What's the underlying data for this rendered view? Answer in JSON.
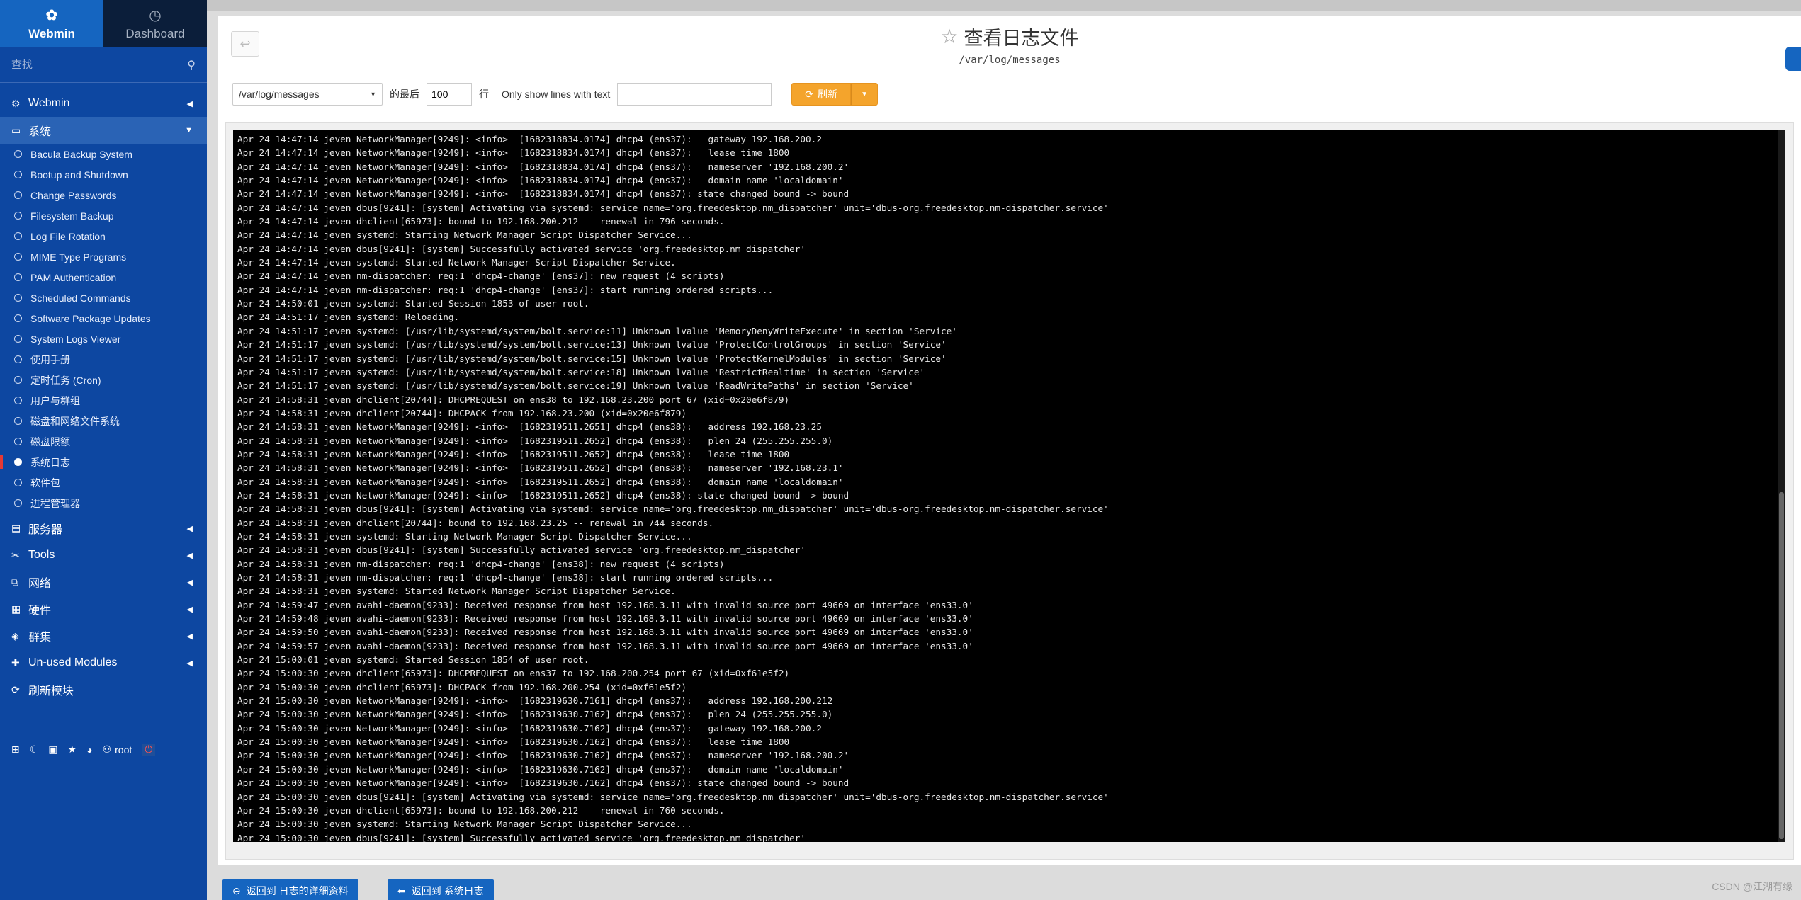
{
  "sidebar": {
    "tabs": {
      "webmin": "Webmin",
      "dashboard": "Dashboard"
    },
    "search_placeholder": "查找",
    "categories_top": [
      {
        "label": "Webmin",
        "icon": "gear-icon"
      },
      {
        "label": "系统",
        "icon": "laptop-icon",
        "open": true
      }
    ],
    "modules": [
      "Bacula Backup System",
      "Bootup and Shutdown",
      "Change Passwords",
      "Filesystem Backup",
      "Log File Rotation",
      "MIME Type Programs",
      "PAM Authentication",
      "Scheduled Commands",
      "Software Package Updates",
      "System Logs Viewer",
      "使用手册",
      "定时任务 (Cron)",
      "用户与群组",
      "磁盘和网络文件系统",
      "磁盘限额",
      "系统日志",
      "软件包",
      "进程管理器"
    ],
    "active_module": "系统日志",
    "categories_bottom": [
      {
        "label": "服务器",
        "icon": "server-icon"
      },
      {
        "label": "Tools",
        "icon": "tools-icon"
      },
      {
        "label": "网络",
        "icon": "network-icon"
      },
      {
        "label": "硬件",
        "icon": "hardware-icon"
      },
      {
        "label": "群集",
        "icon": "cluster-icon"
      },
      {
        "label": "Un-used Modules",
        "icon": "puzzle-icon"
      },
      {
        "label": "刷新模块",
        "icon": "refresh-icon"
      }
    ],
    "footer": {
      "user": "root"
    }
  },
  "header": {
    "title": "查看日志文件",
    "subtitle": "/var/log/messages"
  },
  "toolbar": {
    "file_value": "/var/log/messages",
    "last_label": "的最后",
    "lines_value": "100",
    "lines_unit": "行",
    "filter_label": "Only show lines with text",
    "filter_value": "",
    "refresh_label": "刷新"
  },
  "log": {
    "lines": [
      "Apr 24 14:47:14 jeven NetworkManager[9249]: <info>  [1682318834.0174] dhcp4 (ens37):   gateway 192.168.200.2",
      "Apr 24 14:47:14 jeven NetworkManager[9249]: <info>  [1682318834.0174] dhcp4 (ens37):   lease time 1800",
      "Apr 24 14:47:14 jeven NetworkManager[9249]: <info>  [1682318834.0174] dhcp4 (ens37):   nameserver '192.168.200.2'",
      "Apr 24 14:47:14 jeven NetworkManager[9249]: <info>  [1682318834.0174] dhcp4 (ens37):   domain name 'localdomain'",
      "Apr 24 14:47:14 jeven NetworkManager[9249]: <info>  [1682318834.0174] dhcp4 (ens37): state changed bound -> bound",
      "Apr 24 14:47:14 jeven dbus[9241]: [system] Activating via systemd: service name='org.freedesktop.nm_dispatcher' unit='dbus-org.freedesktop.nm-dispatcher.service'",
      "Apr 24 14:47:14 jeven dhclient[65973]: bound to 192.168.200.212 -- renewal in 796 seconds.",
      "Apr 24 14:47:14 jeven systemd: Starting Network Manager Script Dispatcher Service...",
      "Apr 24 14:47:14 jeven dbus[9241]: [system] Successfully activated service 'org.freedesktop.nm_dispatcher'",
      "Apr 24 14:47:14 jeven systemd: Started Network Manager Script Dispatcher Service.",
      "Apr 24 14:47:14 jeven nm-dispatcher: req:1 'dhcp4-change' [ens37]: new request (4 scripts)",
      "Apr 24 14:47:14 jeven nm-dispatcher: req:1 'dhcp4-change' [ens37]: start running ordered scripts...",
      "Apr 24 14:50:01 jeven systemd: Started Session 1853 of user root.",
      "Apr 24 14:51:17 jeven systemd: Reloading.",
      "Apr 24 14:51:17 jeven systemd: [/usr/lib/systemd/system/bolt.service:11] Unknown lvalue 'MemoryDenyWriteExecute' in section 'Service'",
      "Apr 24 14:51:17 jeven systemd: [/usr/lib/systemd/system/bolt.service:13] Unknown lvalue 'ProtectControlGroups' in section 'Service'",
      "Apr 24 14:51:17 jeven systemd: [/usr/lib/systemd/system/bolt.service:15] Unknown lvalue 'ProtectKernelModules' in section 'Service'",
      "Apr 24 14:51:17 jeven systemd: [/usr/lib/systemd/system/bolt.service:18] Unknown lvalue 'RestrictRealtime' in section 'Service'",
      "Apr 24 14:51:17 jeven systemd: [/usr/lib/systemd/system/bolt.service:19] Unknown lvalue 'ReadWritePaths' in section 'Service'",
      "Apr 24 14:58:31 jeven dhclient[20744]: DHCPREQUEST on ens38 to 192.168.23.200 port 67 (xid=0x20e6f879)",
      "Apr 24 14:58:31 jeven dhclient[20744]: DHCPACK from 192.168.23.200 (xid=0x20e6f879)",
      "Apr 24 14:58:31 jeven NetworkManager[9249]: <info>  [1682319511.2651] dhcp4 (ens38):   address 192.168.23.25",
      "Apr 24 14:58:31 jeven NetworkManager[9249]: <info>  [1682319511.2652] dhcp4 (ens38):   plen 24 (255.255.255.0)",
      "Apr 24 14:58:31 jeven NetworkManager[9249]: <info>  [1682319511.2652] dhcp4 (ens38):   lease time 1800",
      "Apr 24 14:58:31 jeven NetworkManager[9249]: <info>  [1682319511.2652] dhcp4 (ens38):   nameserver '192.168.23.1'",
      "Apr 24 14:58:31 jeven NetworkManager[9249]: <info>  [1682319511.2652] dhcp4 (ens38):   domain name 'localdomain'",
      "Apr 24 14:58:31 jeven NetworkManager[9249]: <info>  [1682319511.2652] dhcp4 (ens38): state changed bound -> bound",
      "Apr 24 14:58:31 jeven dbus[9241]: [system] Activating via systemd: service name='org.freedesktop.nm_dispatcher' unit='dbus-org.freedesktop.nm-dispatcher.service'",
      "Apr 24 14:58:31 jeven dhclient[20744]: bound to 192.168.23.25 -- renewal in 744 seconds.",
      "Apr 24 14:58:31 jeven systemd: Starting Network Manager Script Dispatcher Service...",
      "Apr 24 14:58:31 jeven dbus[9241]: [system] Successfully activated service 'org.freedesktop.nm_dispatcher'",
      "Apr 24 14:58:31 jeven nm-dispatcher: req:1 'dhcp4-change' [ens38]: new request (4 scripts)",
      "Apr 24 14:58:31 jeven nm-dispatcher: req:1 'dhcp4-change' [ens38]: start running ordered scripts...",
      "Apr 24 14:58:31 jeven systemd: Started Network Manager Script Dispatcher Service.",
      "Apr 24 14:59:47 jeven avahi-daemon[9233]: Received response from host 192.168.3.11 with invalid source port 49669 on interface 'ens33.0'",
      "Apr 24 14:59:48 jeven avahi-daemon[9233]: Received response from host 192.168.3.11 with invalid source port 49669 on interface 'ens33.0'",
      "Apr 24 14:59:50 jeven avahi-daemon[9233]: Received response from host 192.168.3.11 with invalid source port 49669 on interface 'ens33.0'",
      "Apr 24 14:59:57 jeven avahi-daemon[9233]: Received response from host 192.168.3.11 with invalid source port 49669 on interface 'ens33.0'",
      "Apr 24 15:00:01 jeven systemd: Started Session 1854 of user root.",
      "Apr 24 15:00:30 jeven dhclient[65973]: DHCPREQUEST on ens37 to 192.168.200.254 port 67 (xid=0xf61e5f2)",
      "Apr 24 15:00:30 jeven dhclient[65973]: DHCPACK from 192.168.200.254 (xid=0xf61e5f2)",
      "Apr 24 15:00:30 jeven NetworkManager[9249]: <info>  [1682319630.7161] dhcp4 (ens37):   address 192.168.200.212",
      "Apr 24 15:00:30 jeven NetworkManager[9249]: <info>  [1682319630.7162] dhcp4 (ens37):   plen 24 (255.255.255.0)",
      "Apr 24 15:00:30 jeven NetworkManager[9249]: <info>  [1682319630.7162] dhcp4 (ens37):   gateway 192.168.200.2",
      "Apr 24 15:00:30 jeven NetworkManager[9249]: <info>  [1682319630.7162] dhcp4 (ens37):   lease time 1800",
      "Apr 24 15:00:30 jeven NetworkManager[9249]: <info>  [1682319630.7162] dhcp4 (ens37):   nameserver '192.168.200.2'",
      "Apr 24 15:00:30 jeven NetworkManager[9249]: <info>  [1682319630.7162] dhcp4 (ens37):   domain name 'localdomain'",
      "Apr 24 15:00:30 jeven NetworkManager[9249]: <info>  [1682319630.7162] dhcp4 (ens37): state changed bound -> bound",
      "Apr 24 15:00:30 jeven dbus[9241]: [system] Activating via systemd: service name='org.freedesktop.nm_dispatcher' unit='dbus-org.freedesktop.nm-dispatcher.service'",
      "Apr 24 15:00:30 jeven dhclient[65973]: bound to 192.168.200.212 -- renewal in 760 seconds.",
      "Apr 24 15:00:30 jeven systemd: Starting Network Manager Script Dispatcher Service...",
      "Apr 24 15:00:30 jeven dbus[9241]: [system] Successfully activated service 'org.freedesktop.nm_dispatcher'"
    ]
  },
  "footer_buttons": {
    "back_details": "返回到 日志的详细资料",
    "back_syslog": "返回到 系统日志"
  },
  "watermark": "CSDN @江湖有缘",
  "colors": {
    "sidebar": "#0d47a1",
    "accent": "#1565c0",
    "refresh": "#f4a42c",
    "log_bg": "#000000"
  }
}
